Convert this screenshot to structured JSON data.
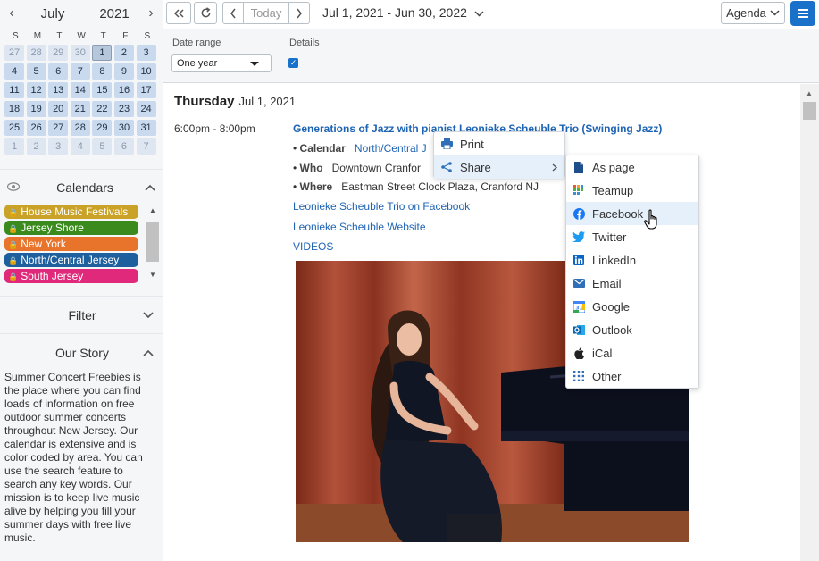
{
  "mini_calendar": {
    "month": "July",
    "year": "2021",
    "dow": [
      "S",
      "M",
      "T",
      "W",
      "T",
      "F",
      "S"
    ],
    "days": [
      {
        "d": "27",
        "o": true
      },
      {
        "d": "28",
        "o": true
      },
      {
        "d": "29",
        "o": true
      },
      {
        "d": "30",
        "o": true
      },
      {
        "d": "1",
        "t": true
      },
      {
        "d": "2"
      },
      {
        "d": "3"
      },
      {
        "d": "4"
      },
      {
        "d": "5"
      },
      {
        "d": "6"
      },
      {
        "d": "7"
      },
      {
        "d": "8"
      },
      {
        "d": "9"
      },
      {
        "d": "10"
      },
      {
        "d": "11"
      },
      {
        "d": "12"
      },
      {
        "d": "13"
      },
      {
        "d": "14"
      },
      {
        "d": "15"
      },
      {
        "d": "16"
      },
      {
        "d": "17"
      },
      {
        "d": "18"
      },
      {
        "d": "19"
      },
      {
        "d": "20"
      },
      {
        "d": "21"
      },
      {
        "d": "22"
      },
      {
        "d": "23"
      },
      {
        "d": "24"
      },
      {
        "d": "25"
      },
      {
        "d": "26"
      },
      {
        "d": "27"
      },
      {
        "d": "28"
      },
      {
        "d": "29"
      },
      {
        "d": "30"
      },
      {
        "d": "31"
      },
      {
        "d": "1",
        "o": true
      },
      {
        "d": "2",
        "o": true
      },
      {
        "d": "3",
        "o": true
      },
      {
        "d": "4",
        "o": true
      },
      {
        "d": "5",
        "o": true
      },
      {
        "d": "6",
        "o": true
      },
      {
        "d": "7",
        "o": true
      }
    ]
  },
  "calendars": {
    "title": "Calendars",
    "items": [
      {
        "label": "House Music Festivals",
        "color": "#c9a227"
      },
      {
        "label": "Jersey Shore",
        "color": "#3a8a1e"
      },
      {
        "label": "New York",
        "color": "#e8732a"
      },
      {
        "label": "North/Central Jersey",
        "color": "#1e5f9e"
      },
      {
        "label": "South Jersey",
        "color": "#e0297a"
      }
    ]
  },
  "filter": {
    "title": "Filter"
  },
  "story": {
    "title": "Our Story",
    "lines": [
      "Summer Concert Freebies is",
      "the place where you can find",
      "loads of information on free",
      "outdoor summer concerts",
      "throughout New Jersey.  Our",
      "calendar is extensive and is",
      "color coded by area. You can",
      "use the search feature to",
      "search any key words. Our",
      "mission is to keep live music",
      "alive by helping you fill your",
      "summer days with free live",
      "music."
    ]
  },
  "toolbar": {
    "today_label": "Today",
    "range_label": "Jul 1, 2021 - Jun 30, 2022",
    "view_label": "Agenda"
  },
  "options": {
    "date_range_label": "Date range",
    "date_range_value": "One year",
    "details_label": "Details"
  },
  "agenda": {
    "weekday": "Thursday",
    "date": "Jul 1, 2021",
    "event": {
      "time": "6:00pm - 8:00pm",
      "title": "Generations of Jazz with pianist Leonieke Scheuble Trio (Swinging Jazz)",
      "calendar_label": "Calendar",
      "calendar_value": "North/Central J",
      "who_label": "Who",
      "who_value": "Downtown Cranfor",
      "where_label": "Where",
      "where_value": "Eastman Street Clock Plaza, Cranford NJ",
      "links": [
        "Leonieke Scheuble Trio on Facebook",
        "Leonieke Scheuble Website",
        "VIDEOS"
      ]
    }
  },
  "context_menu": {
    "print": "Print",
    "share": "Share"
  },
  "share_menu": {
    "items": [
      {
        "label": "As page",
        "icon": "page-icon"
      },
      {
        "label": "Teamup",
        "icon": "teamup-icon"
      },
      {
        "label": "Facebook",
        "icon": "facebook-icon"
      },
      {
        "label": "Twitter",
        "icon": "twitter-icon"
      },
      {
        "label": "LinkedIn",
        "icon": "linkedin-icon"
      },
      {
        "label": "Email",
        "icon": "email-icon"
      },
      {
        "label": "Google",
        "icon": "google-icon"
      },
      {
        "label": "Outlook",
        "icon": "outlook-icon"
      },
      {
        "label": "iCal",
        "icon": "apple-icon"
      },
      {
        "label": "Other",
        "icon": "grid-icon"
      }
    ]
  }
}
